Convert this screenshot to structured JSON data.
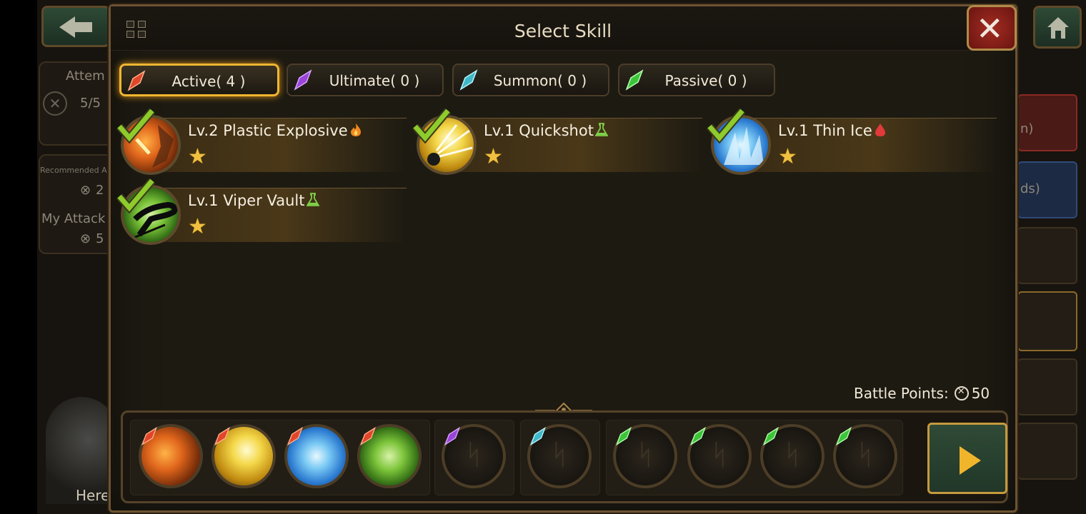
{
  "background": {
    "attempts_label": "Attem",
    "attempts_value": "5/5",
    "recommended_label": "Recommended A",
    "recommended_value": "2",
    "my_attack_label": "My Attack",
    "my_attack_value": "5",
    "hero_label": "Here",
    "right_text_1": "n)",
    "right_text_2": "ds)"
  },
  "modal": {
    "title": "Select Skill",
    "close_label": "✕"
  },
  "tabs": [
    {
      "label": "Active( 4 )",
      "gem_color": "#e0462a",
      "active": true
    },
    {
      "label": "Ultimate( 0 )",
      "gem_color": "#9a44d8",
      "active": false
    },
    {
      "label": "Summon( 0 )",
      "gem_color": "#3fb8c8",
      "active": false
    },
    {
      "label": "Passive( 0 )",
      "gem_color": "#3cc43a",
      "active": false
    }
  ],
  "skills": [
    {
      "name": "Lv.2 Plastic Explosive",
      "tag_icon": "fire-icon",
      "stars": "★",
      "theme": "fire"
    },
    {
      "name": "Lv.1 Quickshot",
      "tag_icon": "flask-icon",
      "stars": "★",
      "theme": "light"
    },
    {
      "name": "Lv.1 Thin Ice",
      "tag_icon": "blood-drop-icon",
      "stars": "★",
      "theme": "ice"
    },
    {
      "name": "Lv.1 Viper Vault",
      "tag_icon": "flask-icon",
      "stars": "★",
      "theme": "poison"
    }
  ],
  "battle_points": {
    "label": "Battle Points:",
    "value": "50"
  },
  "colors": {
    "accent_gold": "#f1b631",
    "frame_brown": "#6d5332",
    "active_gem": "#e0462a",
    "ultimate_gem": "#9a44d8",
    "summon_gem": "#3fb8c8",
    "passive_gem": "#3cc43a"
  }
}
